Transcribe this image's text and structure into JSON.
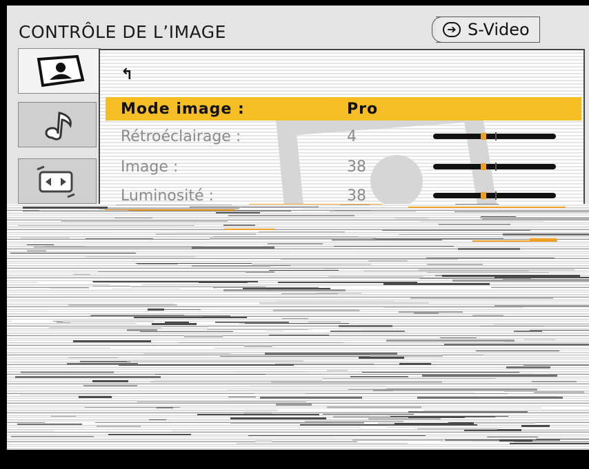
{
  "header": {
    "title": "CONTRÔLE DE L’IMAGE",
    "source_label": "S-Video",
    "source_icon": "input-arrow-icon"
  },
  "tabs": [
    {
      "name": "picture-tab",
      "icon": "picture-icon",
      "active": true
    },
    {
      "name": "audio-tab",
      "icon": "music-note-icon",
      "active": false
    },
    {
      "name": "screen-tab",
      "icon": "screen-adjust-icon",
      "active": false
    }
  ],
  "menu": {
    "back_glyph": "↰",
    "rows": [
      {
        "label": "Mode image :",
        "value": "Pro",
        "state": "selected"
      },
      {
        "label": "Rétroéclairage :",
        "value": "4",
        "state": "dim",
        "slider_level": 0.5
      },
      {
        "label": "Image :",
        "value": "38",
        "state": "dim",
        "slider_level": 0.5
      },
      {
        "label": "Luminosité :",
        "value": "38",
        "state": "dim",
        "slider_level": 0.5
      }
    ]
  },
  "colors": {
    "highlight": "#f7bd25",
    "slider_thumb": "#f0a020",
    "dim_text": "#8a8a8a"
  }
}
